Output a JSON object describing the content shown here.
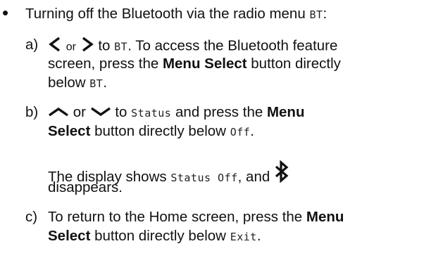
{
  "bullet": "•",
  "intro": {
    "text": "Turning off the Bluetooth via the radio menu ",
    "code": "BT",
    "tail": ":"
  },
  "step_a": {
    "label": "a)",
    "or": "or",
    "to": " to ",
    "code1": "BT",
    "text1": ". To access the Bluetooth feature",
    "line2": "screen, press the ",
    "bold1": "Menu Select",
    "text2": " button directly",
    "line3": "below ",
    "code2": "BT",
    "text3": "."
  },
  "step_b": {
    "label": "b)",
    "or": "or",
    "to": " to ",
    "code1": "Status",
    "text1": " and press the ",
    "bold1": "Menu",
    "bold2": "Select",
    "text2": " button directly below ",
    "code2": "Off",
    "text3": "."
  },
  "note": {
    "text1": "The display shows ",
    "code1": "Status Off",
    "text2": ", and ",
    "line2": "disappears."
  },
  "step_c": {
    "label": "c)",
    "text1": "To return to the Home screen, press the ",
    "bold1": "Menu",
    "bold2": "Select",
    "text2": " button directly below ",
    "code1": "Exit",
    "text3": "."
  },
  "icons": {
    "left": "chevron-left-icon",
    "right": "chevron-right-icon",
    "up": "chevron-up-icon",
    "down": "chevron-down-icon",
    "bluetooth": "bluetooth-icon"
  }
}
